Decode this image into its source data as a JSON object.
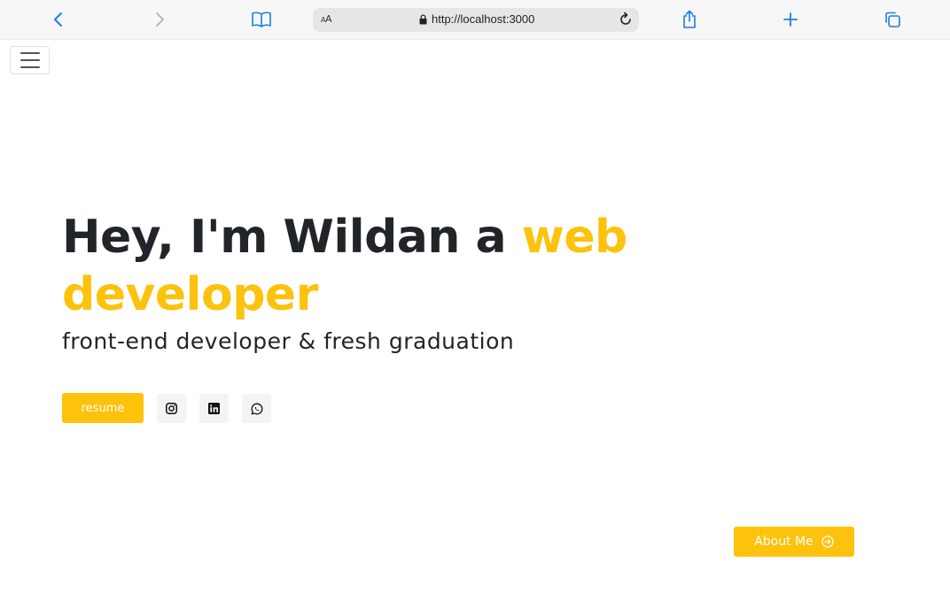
{
  "browser": {
    "reader_label": "AA",
    "url": "http://localhost:3000"
  },
  "hero": {
    "title_main": "Hey, I'm Wildan a ",
    "title_accent": "web developer",
    "subtitle": "front-end developer & fresh graduation"
  },
  "actions": {
    "resume_label": "resume",
    "about_label": "About Me"
  },
  "social": [
    "instagram-icon",
    "linkedin-icon",
    "whatsapp-icon"
  ],
  "colors": {
    "accent": "#fcc20c",
    "text": "#212529",
    "browser_blue": "#1a7ee6"
  }
}
